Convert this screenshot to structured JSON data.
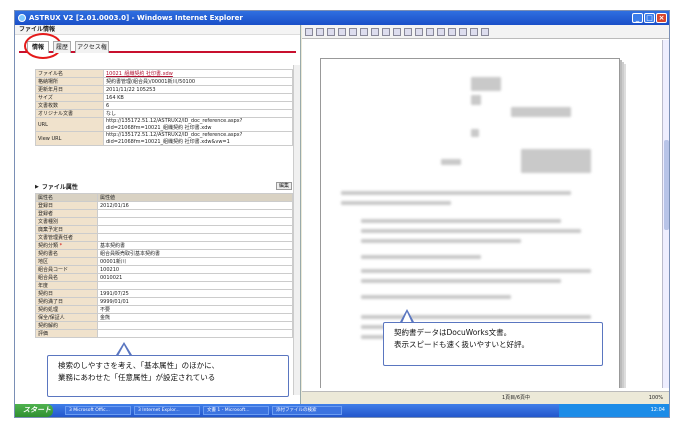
{
  "window": {
    "title": "ASTRUX V2 [2.01.0003.0] - Windows Internet Explorer"
  },
  "left": {
    "header": "ファイル情報",
    "tabs": [
      {
        "label": "情報"
      },
      {
        "label": "履歴"
      },
      {
        "label": "アクセス権"
      }
    ],
    "info_rows": [
      {
        "k": "ファイル名",
        "v": "10021_組織契約 社印書.xdw"
      },
      {
        "k": "格納場所",
        "v": "契約書管理(組合員)/00001新川/50100"
      },
      {
        "k": "更新年月日",
        "v": "2011/11/22 105253"
      },
      {
        "k": "サイズ",
        "v": "164 KB"
      },
      {
        "k": "文書枚数",
        "v": "6"
      },
      {
        "k": "オリジナル文書",
        "v": "なし"
      },
      {
        "k": "URL",
        "v": "http://135172.51.12/ASTRUX2/ID_doc_reference.aspx?did=21068fm=10021_組織契約 社印書.xdw"
      },
      {
        "k": "View URL",
        "v": "http://135172.51.12/ASTRUX2/ID_doc_reference.aspx?did=21068fm=10021_組織契約 社印書.xdw&vw=1"
      }
    ],
    "section_attr": "ファイル属性",
    "edit_label": "編集",
    "attr_header": {
      "k": "属性名",
      "v": "属性値"
    },
    "attr_rows": [
      {
        "k": "登録日",
        "v": "2012/01/16"
      },
      {
        "k": "登録者",
        "v": ""
      },
      {
        "k": "文書種別",
        "v": ""
      },
      {
        "k": "廃棄予定日",
        "v": ""
      },
      {
        "k": "文書管理責任者",
        "v": ""
      },
      {
        "k": "契約分類",
        "v": "基本契約書",
        "req": "*"
      },
      {
        "k": "契約書名",
        "v": "組合員販売取引基本契約書"
      },
      {
        "k": "地区",
        "v": "00001新川"
      },
      {
        "k": "組合員コード",
        "v": "100210"
      },
      {
        "k": "組合員名",
        "v": "0010021"
      },
      {
        "k": "年度",
        "v": ""
      },
      {
        "k": "契約日",
        "v": "1991/07/25"
      },
      {
        "k": "契約満了日",
        "v": "9999/01/01"
      },
      {
        "k": "契約処理",
        "v": "不要"
      },
      {
        "k": "保全/保証人",
        "v": "金熊"
      },
      {
        "k": "契約解約",
        "v": ""
      },
      {
        "k": "評価",
        "v": ""
      }
    ]
  },
  "viewer": {
    "status_page": "1頁目/6頁中",
    "zoom": "100%"
  },
  "taskbar": {
    "start": "スタート",
    "tasks": [
      "3 Microsoft Offic...",
      "3 Internet Explor...",
      "文書 1 - Microsoft...",
      "添付ファイルの検索"
    ],
    "clock": "12:04"
  },
  "callouts": {
    "left": {
      "line1": "検索のしやすさを考え、「基本属性」のほかに、",
      "line2": "業務にあわせた「任意属性」が設定されている"
    },
    "right": {
      "line1": "契約書データはDocuWorks文書。",
      "line2": "表示スピードも速く扱いやすいと好評。"
    }
  }
}
